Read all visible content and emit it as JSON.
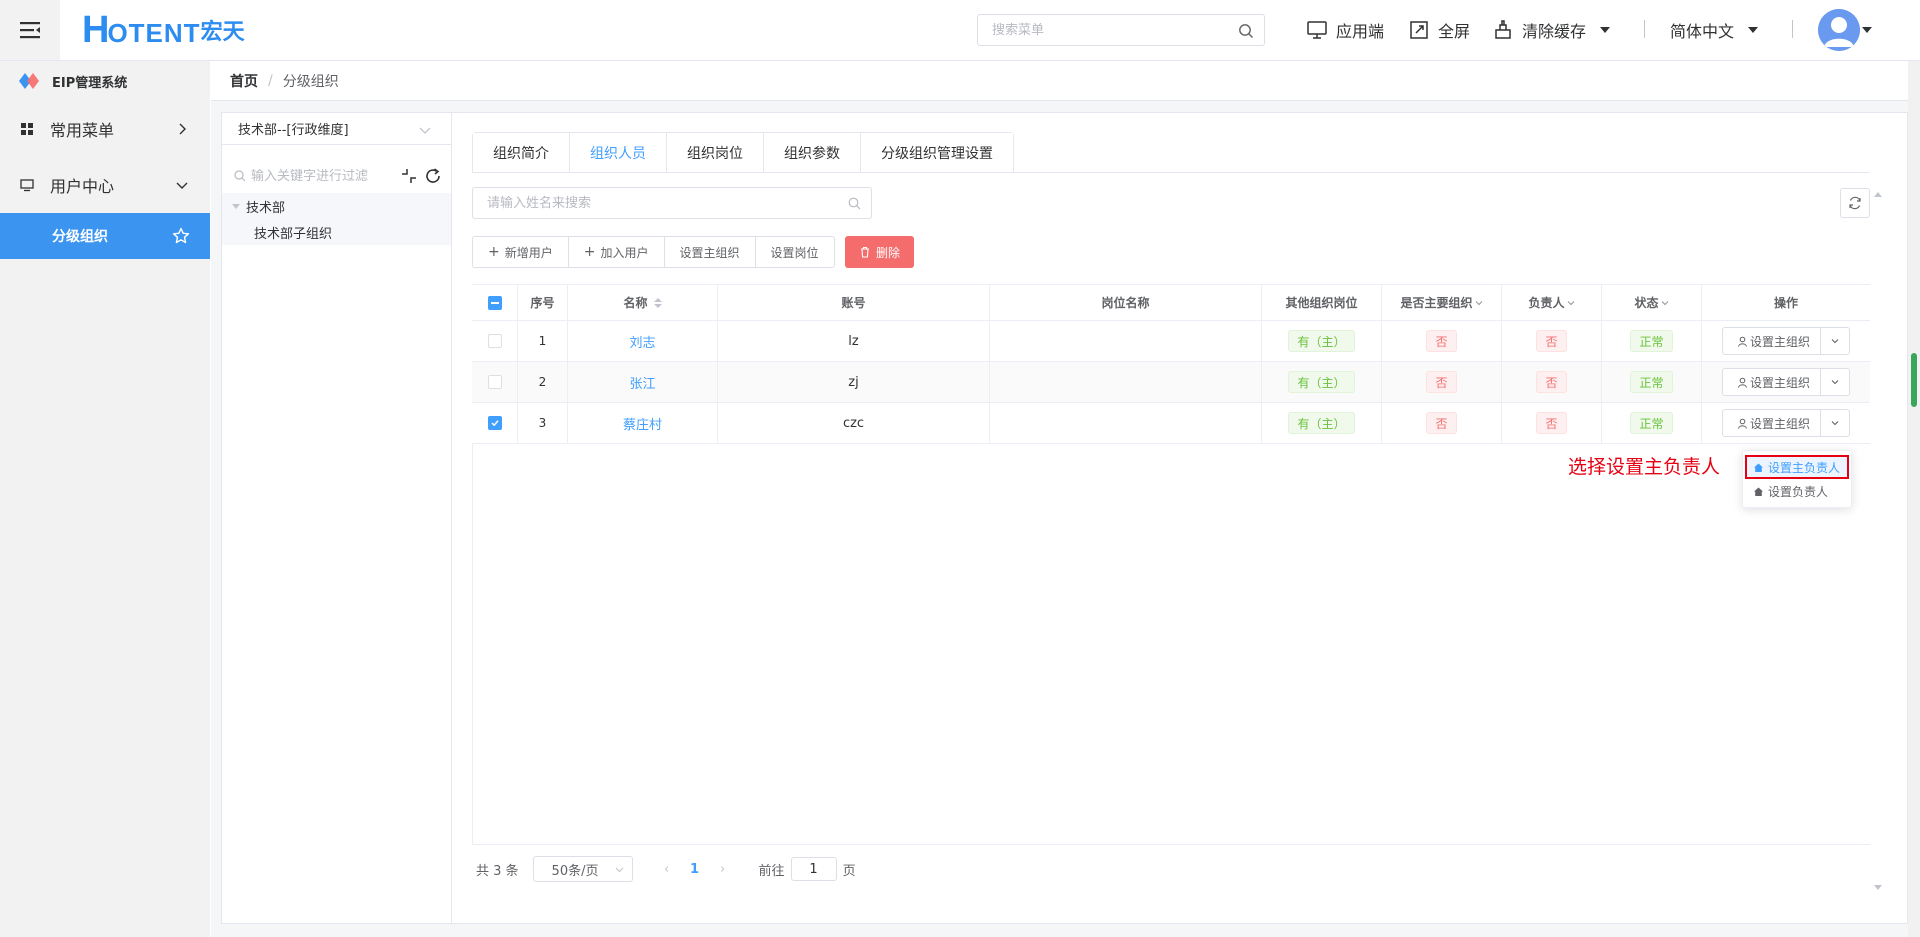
{
  "header": {
    "logo_h": "H",
    "logo_rest": "OTENT",
    "logo_cn": "宏天",
    "search_placeholder": "搜索菜单",
    "actions": {
      "app": "应用端",
      "fullscreen": "全屏",
      "clear_cache": "清除缓存",
      "language": "简体中文"
    }
  },
  "sidebar": {
    "brand": "EIP管理系统",
    "items": [
      {
        "label": "常用菜单"
      },
      {
        "label": "用户中心"
      },
      {
        "label": "分级组织"
      }
    ]
  },
  "breadcrumb": {
    "home": "首页",
    "separator": "/",
    "current": "分级组织"
  },
  "tree": {
    "dimension": "技术部--[行政维度]",
    "filter_placeholder": "输入关键字进行过滤",
    "nodes": [
      {
        "label": "技术部"
      },
      {
        "label": "技术部子组织"
      }
    ]
  },
  "tabs": [
    "组织简介",
    "组织人员",
    "组织岗位",
    "组织参数",
    "分级组织管理设置"
  ],
  "name_search_placeholder": "请输入姓名来搜索",
  "toolbar": {
    "add_user": "新增用户",
    "join_user": "加入用户",
    "set_main_org": "设置主组织",
    "set_post": "设置岗位",
    "delete": "删除"
  },
  "table": {
    "headers": {
      "index": "序号",
      "name": "名称",
      "account": "账号",
      "post": "岗位名称",
      "other_posts": "其他组织岗位",
      "is_main": "是否主要组织",
      "manager": "负责人",
      "status": "状态",
      "ops": "操作"
    },
    "rows": [
      {
        "index": "1",
        "name": "刘志",
        "account": "lz",
        "post": "",
        "other": "有（主）",
        "is_main": "否",
        "manager": "否",
        "status": "正常",
        "op": "设置主组织"
      },
      {
        "index": "2",
        "name": "张江",
        "account": "zj",
        "post": "",
        "other": "有（主）",
        "is_main": "否",
        "manager": "否",
        "status": "正常",
        "op": "设置主组织"
      },
      {
        "index": "3",
        "name": "蔡庄村",
        "account": "czc",
        "post": "",
        "other": "有（主）",
        "is_main": "否",
        "manager": "否",
        "status": "正常",
        "op": "设置主组织"
      }
    ]
  },
  "annotation": "选择设置主负责人",
  "dropdown": {
    "set_main_manager": "设置主负责人",
    "set_manager": "设置负责人"
  },
  "pager": {
    "total": "共 3 条",
    "page_size": "50条/页",
    "prev": "‹",
    "next": "›",
    "current_page": "1",
    "goto_label": "前往",
    "goto_value": "1",
    "page_suffix": "页"
  },
  "colors": {
    "primary": "#409eff",
    "sidebar_active": "#3b95f0",
    "danger": "#f56c6c",
    "success": "#67c23a",
    "annotation": "#e60012"
  }
}
